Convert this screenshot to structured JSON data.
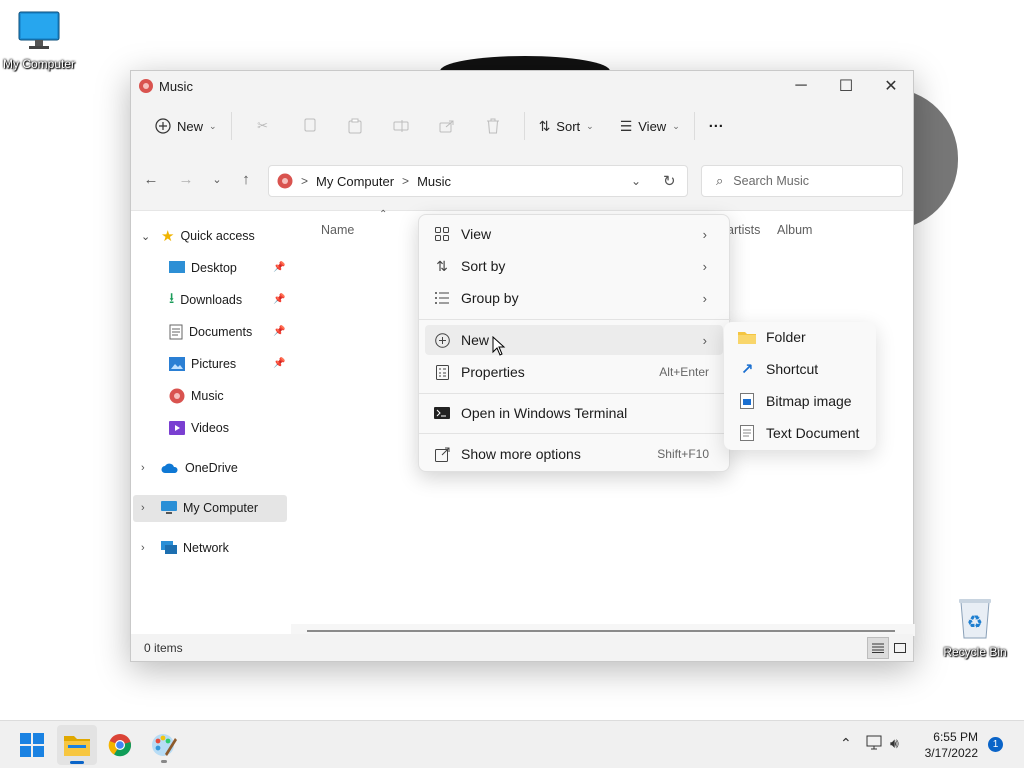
{
  "desktop": {
    "icons": [
      {
        "label": "My Computer"
      },
      {
        "label": "Recycle Bin"
      }
    ]
  },
  "window": {
    "title": "Music",
    "controls": {
      "minimize": "─",
      "maximize": "☐",
      "close": "✕"
    }
  },
  "toolbar": {
    "new_label": "New",
    "sort_label": "Sort",
    "view_label": "View",
    "more_label": "···"
  },
  "address": {
    "path": [
      "My Computer",
      "Music"
    ],
    "separator": ">",
    "search_placeholder": "Search Music"
  },
  "sidebar": {
    "quick_access": "Quick access",
    "items": [
      {
        "label": "Desktop",
        "pinned": true
      },
      {
        "label": "Downloads",
        "pinned": true
      },
      {
        "label": "Documents",
        "pinned": true
      },
      {
        "label": "Pictures",
        "pinned": true
      },
      {
        "label": "Music",
        "pinned": false
      },
      {
        "label": "Videos",
        "pinned": false
      }
    ],
    "onedrive": "OneDrive",
    "my_computer": "My Computer",
    "network": "Network"
  },
  "columns": {
    "name": "Name",
    "artists": "artists",
    "album": "Album"
  },
  "status": {
    "items": "0 items"
  },
  "context_menu": {
    "items": [
      {
        "label": "View",
        "submenu": true
      },
      {
        "label": "Sort by",
        "submenu": true
      },
      {
        "label": "Group by",
        "submenu": true
      },
      {
        "label": "New",
        "submenu": true
      },
      {
        "label": "Properties",
        "accelerator": "Alt+Enter"
      },
      {
        "label": "Open in Windows Terminal"
      },
      {
        "label": "Show more options",
        "accelerator": "Shift+F10"
      }
    ]
  },
  "new_submenu": {
    "items": [
      {
        "label": "Folder"
      },
      {
        "label": "Shortcut"
      },
      {
        "label": "Bitmap image"
      },
      {
        "label": "Text Document"
      }
    ]
  },
  "taskbar": {
    "time": "6:55 PM",
    "date": "3/17/2022",
    "notifications": "1"
  },
  "colors": {
    "accent": "#0a64c8",
    "folder": "#f4c542",
    "music_icon": "#d9534f"
  }
}
